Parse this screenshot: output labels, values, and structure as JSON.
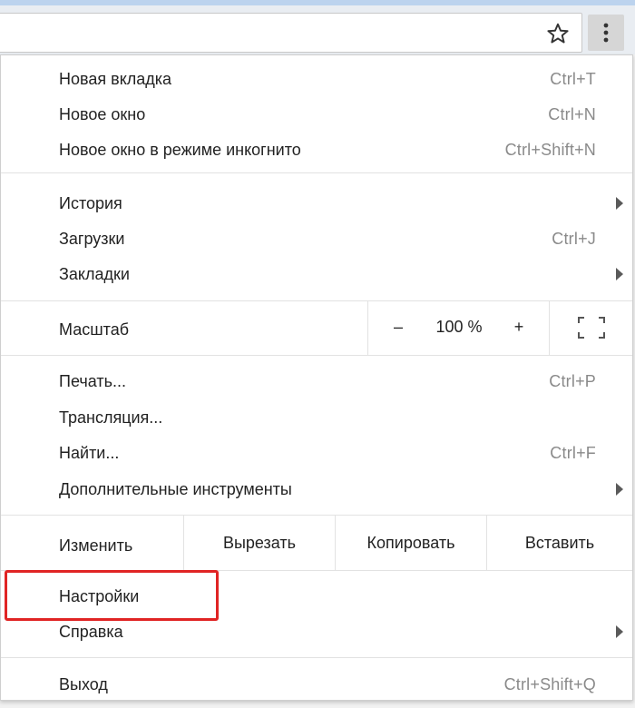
{
  "toolbar": {
    "star_icon": "star-outline-icon",
    "menu_icon": "kebab-menu-icon"
  },
  "menu": {
    "new_tab": {
      "label": "Новая вкладка",
      "shortcut": "Ctrl+T"
    },
    "new_window": {
      "label": "Новое окно",
      "shortcut": "Ctrl+N"
    },
    "incognito": {
      "label": "Новое окно в режиме инкогнито",
      "shortcut": "Ctrl+Shift+N"
    },
    "history": {
      "label": "История"
    },
    "downloads": {
      "label": "Загрузки",
      "shortcut": "Ctrl+J"
    },
    "bookmarks": {
      "label": "Закладки"
    },
    "zoom": {
      "label": "Масштаб",
      "minus": "–",
      "value": "100 %",
      "plus": "+"
    },
    "print": {
      "label": "Печать...",
      "shortcut": "Ctrl+P"
    },
    "cast": {
      "label": "Трансляция..."
    },
    "find": {
      "label": "Найти...",
      "shortcut": "Ctrl+F"
    },
    "more_tools": {
      "label": "Дополнительные инструменты"
    },
    "edit": {
      "label": "Изменить",
      "cut": "Вырезать",
      "copy": "Копировать",
      "paste": "Вставить"
    },
    "settings": {
      "label": "Настройки"
    },
    "help": {
      "label": "Справка"
    },
    "exit": {
      "label": "Выход",
      "shortcut": "Ctrl+Shift+Q"
    }
  },
  "colors": {
    "highlight": "#e02424",
    "shortcut_text": "#8a8a8a"
  }
}
